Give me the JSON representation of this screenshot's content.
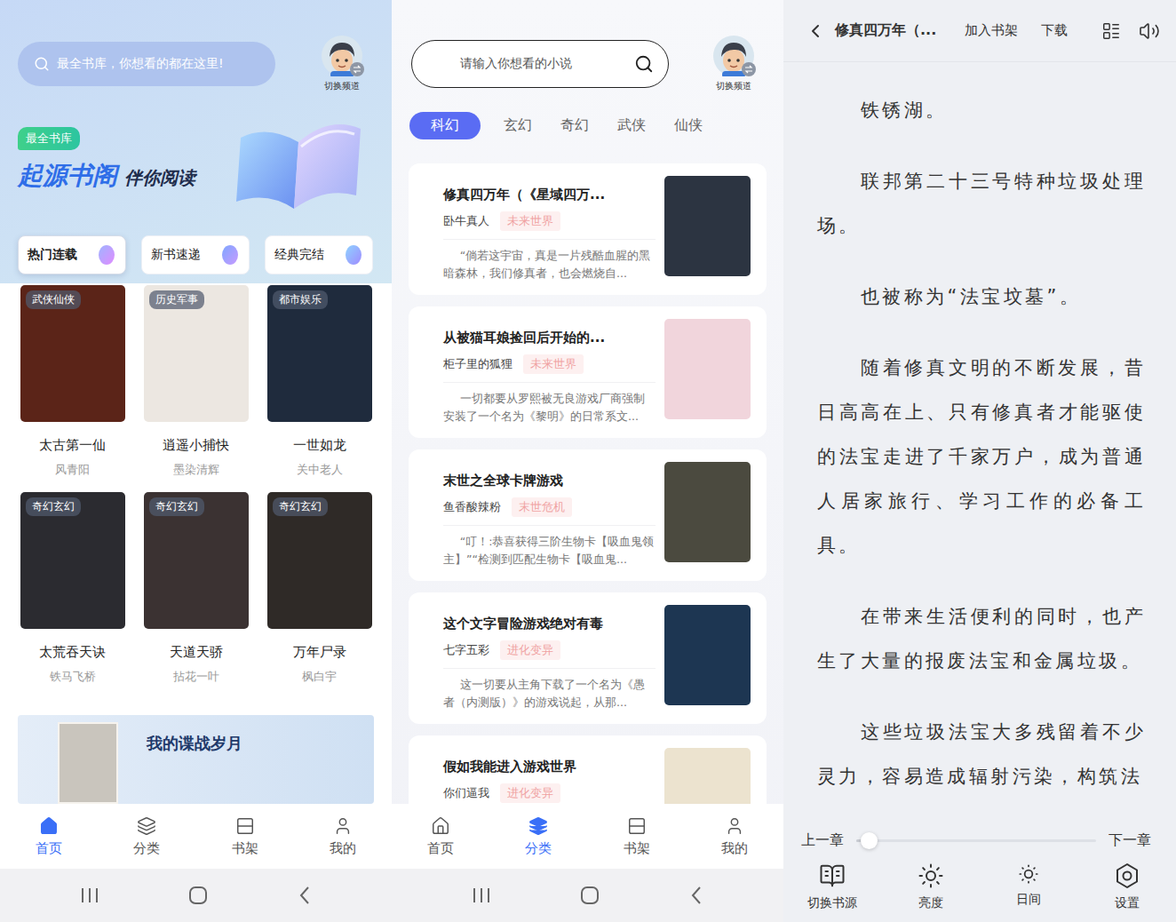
{
  "home": {
    "search_placeholder": "最全书库，你想看的都在这里!",
    "avatar_label": "切换频道",
    "badge": "最全书库",
    "title": "起源书阁",
    "slogan": "伴你阅读",
    "tabs": [
      {
        "label": "热门连载",
        "selected": true
      },
      {
        "label": "新书速递",
        "selected": false
      },
      {
        "label": "经典完结",
        "selected": false
      }
    ],
    "books": [
      {
        "title": "太古第一仙",
        "author": "风青阳",
        "tag": "武侠仙侠"
      },
      {
        "title": "逍遥小捕快",
        "author": "墨染清辉",
        "tag": "历史军事"
      },
      {
        "title": "一世如龙",
        "author": "关中老人",
        "tag": "都市娱乐"
      },
      {
        "title": "太荒吞天诀",
        "author": "铁马飞桥",
        "tag": "奇幻玄幻"
      },
      {
        "title": "天道天骄",
        "author": "拈花一叶",
        "tag": "奇幻玄幻"
      },
      {
        "title": "万年尸录",
        "author": "枫白宇",
        "tag": "奇幻玄幻"
      }
    ],
    "banner": {
      "title": "我的谍战岁月"
    },
    "nav": [
      {
        "label": "首页",
        "selected": true
      },
      {
        "label": "分类",
        "selected": false
      },
      {
        "label": "书架",
        "selected": false
      },
      {
        "label": "我的",
        "selected": false
      }
    ]
  },
  "category": {
    "search_placeholder": "请输入你想看的小说",
    "avatar_label": "切换频道",
    "tabs": [
      {
        "label": "科幻",
        "selected": true
      },
      {
        "label": "玄幻",
        "selected": false
      },
      {
        "label": "奇幻",
        "selected": false
      },
      {
        "label": "武侠",
        "selected": false
      },
      {
        "label": "仙侠",
        "selected": false
      }
    ],
    "books": [
      {
        "title": "修真四万年（《星域四万...",
        "author": "卧牛真人",
        "tag": "未来世界",
        "desc": "“倘若这宇宙，真是一片残酷血腥的黑暗森林，我们修真者，也会燃烧自..."
      },
      {
        "title": "从被猫耳娘捡回后开始的...",
        "author": "柜子里的狐狸",
        "tag": "未来世界",
        "desc": "一切都要从罗熙被无良游戏厂商强制安装了一个名为《黎明》的日常系文..."
      },
      {
        "title": "末世之全球卡牌游戏",
        "author": "鱼香酸辣粉",
        "tag": "末世危机",
        "desc": "“叮！:恭喜获得三阶生物卡【吸血鬼领主】”“检测到匹配生物卡【吸血鬼..."
      },
      {
        "title": "这个文字冒险游戏绝对有毒",
        "author": "七字五彩",
        "tag": "进化变异",
        "desc": "这一切要从主角下载了一个名为《愚者（内测版）》的游戏说起，从那..."
      },
      {
        "title": "假如我能进入游戏世界",
        "author": "你们逼我",
        "tag": "进化变异",
        "desc": ""
      }
    ],
    "nav": [
      {
        "label": "首页",
        "selected": false
      },
      {
        "label": "分类",
        "selected": true
      },
      {
        "label": "书架",
        "selected": false
      },
      {
        "label": "我的",
        "selected": false
      }
    ]
  },
  "reader": {
    "title": "修真四万年（...",
    "actions": [
      "加入书架",
      "下载"
    ],
    "paragraphs": [
      "铁锈湖。",
      "联邦第二十三号特种垃圾处理场。",
      "也被称为“法宝坟墓”。",
      "随着修真文明的不断发展，昔日高高在上、只有修真者才能驱使的法宝走进了千家万户，成为普通人居家旅行、学习工作的必备工具。",
      "在带来生活便利的同时，也产生了大量的报废法宝和金属垃圾。",
      "这些垃圾法宝大多残留着不少灵力，容易造成辐射污染，构筑法"
    ],
    "prev": "上一章",
    "next": "下一章",
    "progress": {
      "level": 0.05
    },
    "tools": [
      "切换书源",
      "亮度",
      "日间",
      "设置"
    ]
  }
}
